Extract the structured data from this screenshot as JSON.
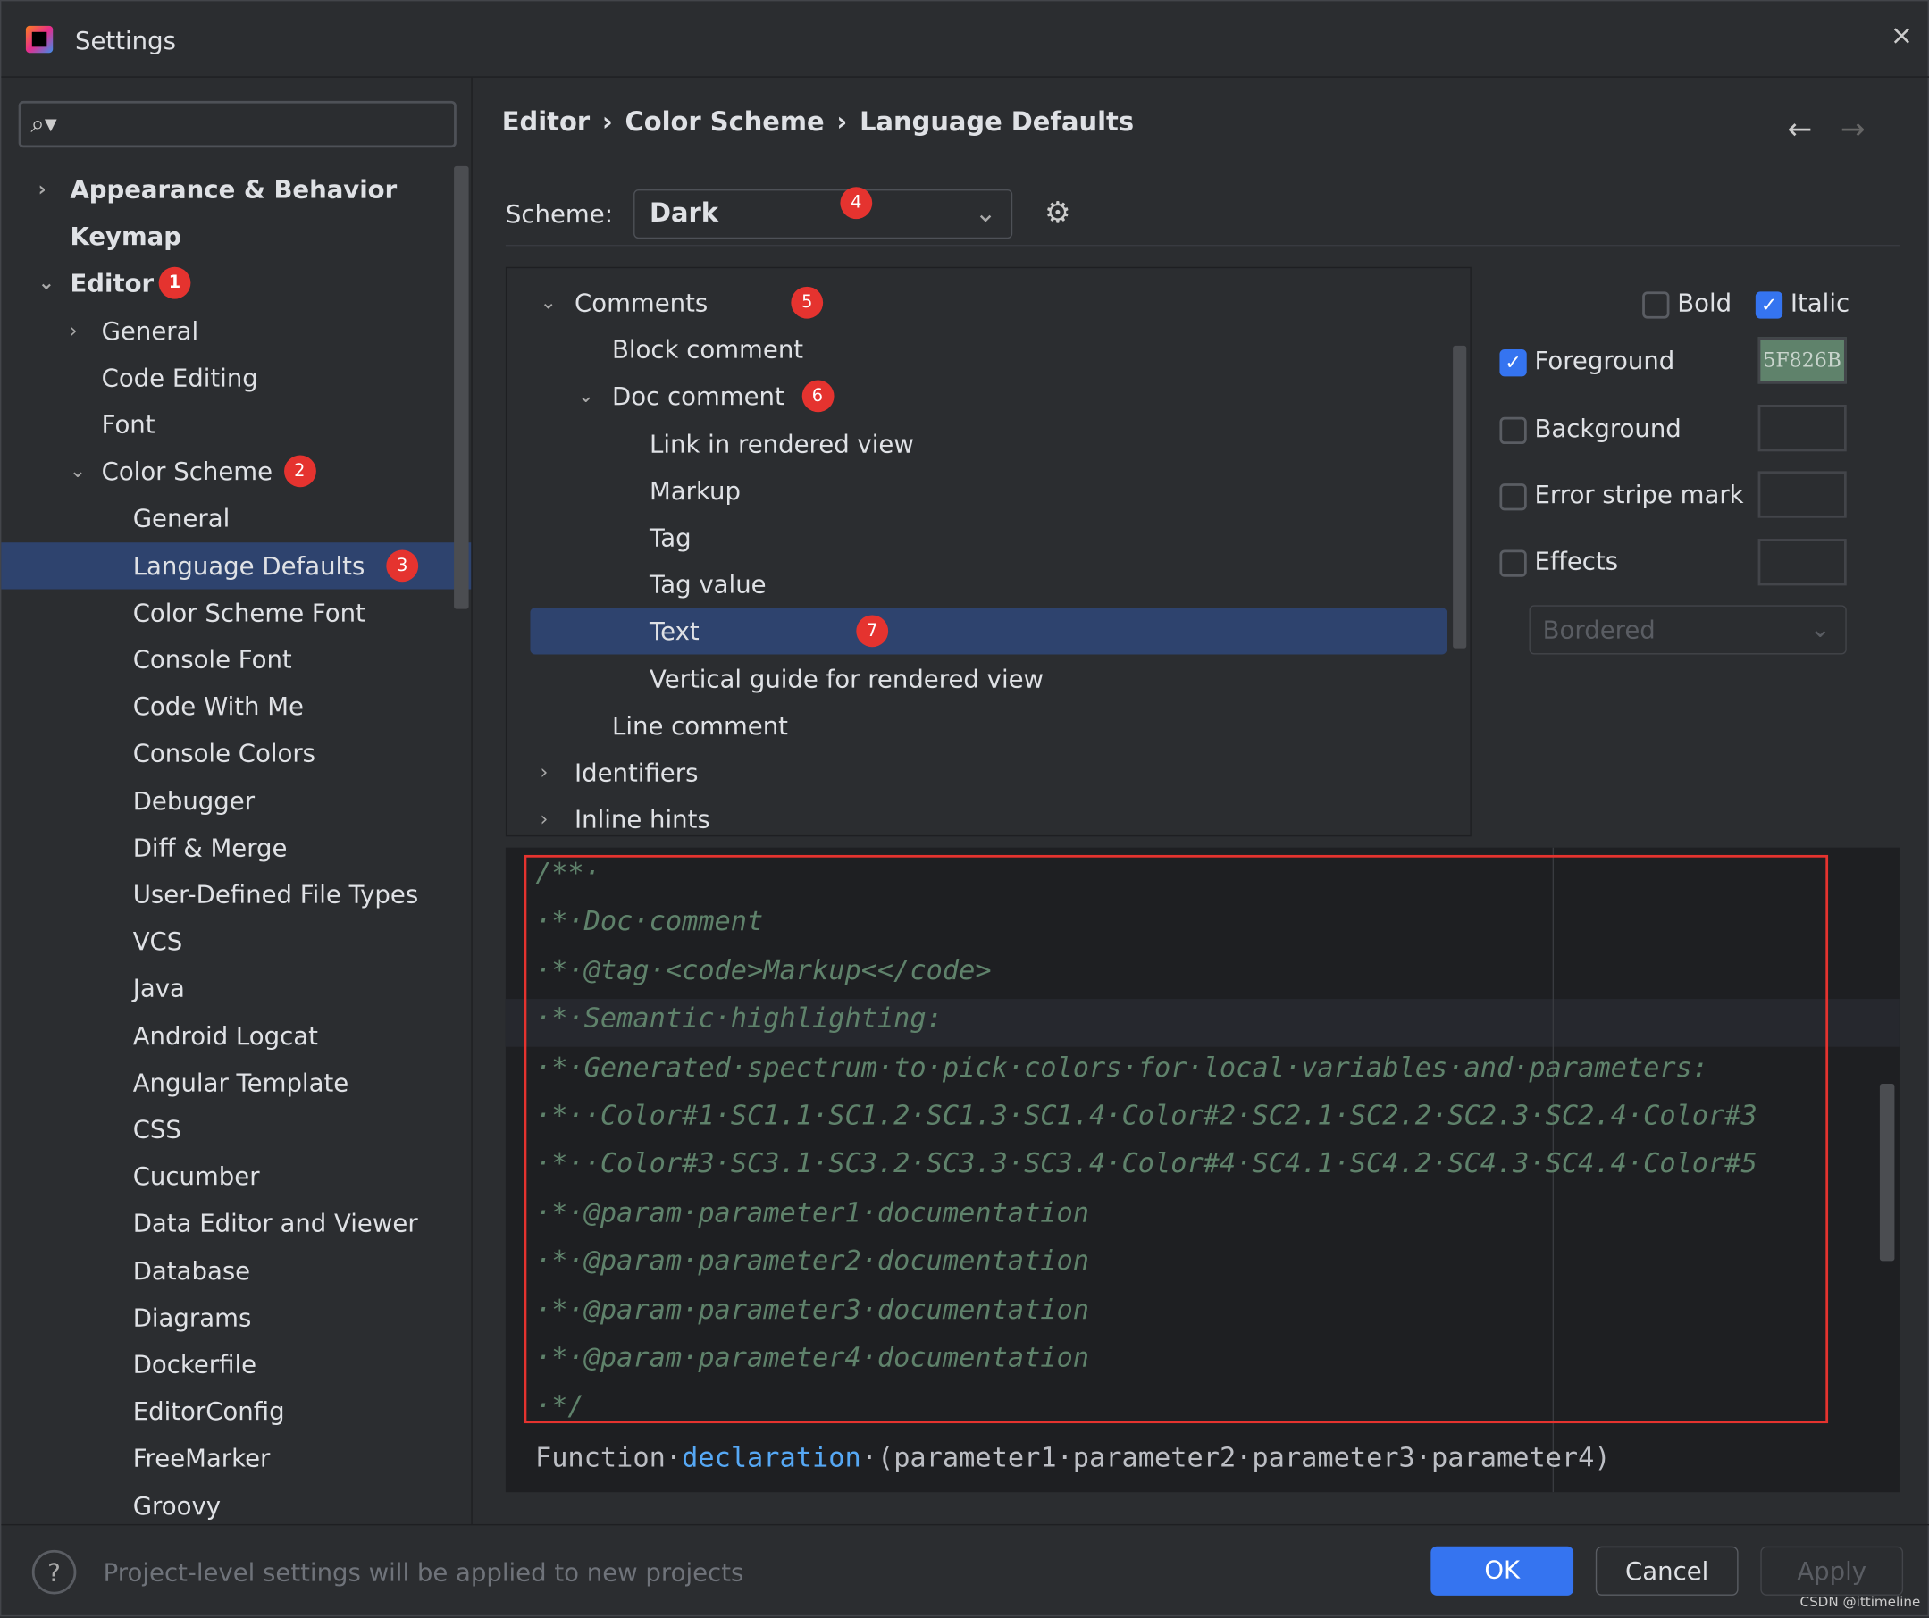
{
  "window": {
    "title": "Settings",
    "close": "×"
  },
  "search": {
    "icon": "⌕▾",
    "placeholder": ""
  },
  "sidebar": {
    "items": [
      {
        "label": "Appearance & Behavior",
        "level": 0,
        "bold": true,
        "chev": "›"
      },
      {
        "label": "Keymap",
        "level": 0,
        "bold": true,
        "chev": ""
      },
      {
        "label": "Editor",
        "level": 0,
        "bold": true,
        "chev": "⌄",
        "badge": "1"
      },
      {
        "label": "General",
        "level": 1,
        "chev": "›"
      },
      {
        "label": "Code Editing",
        "level": 1,
        "chev": ""
      },
      {
        "label": "Font",
        "level": 1,
        "chev": ""
      },
      {
        "label": "Color Scheme",
        "level": 1,
        "chev": "⌄",
        "badge": "2"
      },
      {
        "label": "General",
        "level": 2,
        "chev": ""
      },
      {
        "label": "Language Defaults",
        "level": 2,
        "chev": "",
        "badge": "3",
        "selected": true
      },
      {
        "label": "Color Scheme Font",
        "level": 2,
        "chev": ""
      },
      {
        "label": "Console Font",
        "level": 2,
        "chev": ""
      },
      {
        "label": "Code With Me",
        "level": 2,
        "chev": ""
      },
      {
        "label": "Console Colors",
        "level": 2,
        "chev": ""
      },
      {
        "label": "Debugger",
        "level": 2,
        "chev": ""
      },
      {
        "label": "Diff & Merge",
        "level": 2,
        "chev": ""
      },
      {
        "label": "User-Defined File Types",
        "level": 2,
        "chev": ""
      },
      {
        "label": "VCS",
        "level": 2,
        "chev": ""
      },
      {
        "label": "Java",
        "level": 2,
        "chev": ""
      },
      {
        "label": "Android Logcat",
        "level": 2,
        "chev": ""
      },
      {
        "label": "Angular Template",
        "level": 2,
        "chev": ""
      },
      {
        "label": "CSS",
        "level": 2,
        "chev": ""
      },
      {
        "label": "Cucumber",
        "level": 2,
        "chev": ""
      },
      {
        "label": "Data Editor and Viewer",
        "level": 2,
        "chev": ""
      },
      {
        "label": "Database",
        "level": 2,
        "chev": ""
      },
      {
        "label": "Diagrams",
        "level": 2,
        "chev": ""
      },
      {
        "label": "Dockerfile",
        "level": 2,
        "chev": ""
      },
      {
        "label": "EditorConfig",
        "level": 2,
        "chev": ""
      },
      {
        "label": "FreeMarker",
        "level": 2,
        "chev": ""
      },
      {
        "label": "Groovy",
        "level": 2,
        "chev": ""
      }
    ]
  },
  "breadcrumb": [
    "Editor",
    "›",
    "Color Scheme",
    "›",
    "Language Defaults"
  ],
  "nav": {
    "back": "←",
    "forward": "→"
  },
  "scheme": {
    "label": "Scheme:",
    "value": "Dark",
    "badge": "4",
    "gear": "⚙"
  },
  "attributes": [
    {
      "label": "Comments",
      "level": 0,
      "chev": "⌄",
      "badge": "5"
    },
    {
      "label": "Block comment",
      "level": 1,
      "chev": ""
    },
    {
      "label": "Doc comment",
      "level": 1,
      "chev": "⌄",
      "badge": "6"
    },
    {
      "label": "Link in rendered view",
      "level": 2,
      "chev": ""
    },
    {
      "label": "Markup",
      "level": 2,
      "chev": ""
    },
    {
      "label": "Tag",
      "level": 2,
      "chev": ""
    },
    {
      "label": "Tag value",
      "level": 2,
      "chev": ""
    },
    {
      "label": "Text",
      "level": 2,
      "chev": "",
      "badge": "7",
      "selected": true
    },
    {
      "label": "Vertical guide for rendered view",
      "level": 2,
      "chev": ""
    },
    {
      "label": "Line comment",
      "level": 1,
      "chev": ""
    },
    {
      "label": "Identifiers",
      "level": 0,
      "chev": "›"
    },
    {
      "label": "Inline hints",
      "level": 0,
      "chev": "›"
    }
  ],
  "props": {
    "bold": {
      "label": "Bold",
      "checked": false
    },
    "italic": {
      "label": "Italic",
      "checked": true
    },
    "foreground": {
      "label": "Foreground",
      "checked": true,
      "color": "#5F826B",
      "value": "5F826B"
    },
    "background": {
      "label": "Background",
      "checked": false
    },
    "error_stripe": {
      "label": "Error stripe mark",
      "checked": false
    },
    "effects": {
      "label": "Effects",
      "checked": false
    },
    "effect_type": "Bordered"
  },
  "preview": {
    "lines": [
      "/**·",
      "·*·Doc·comment",
      "·*·@tag·<code>Markup<</code>",
      "·*·Semantic·highlighting:",
      "·*·Generated·spectrum·to·pick·colors·for·local·variables·and·parameters:",
      "·*··Color#1·SC1.1·SC1.2·SC1.3·SC1.4·Color#2·SC2.1·SC2.2·SC2.3·SC2.4·Color#3",
      "·*··Color#3·SC3.1·SC3.2·SC3.3·SC3.4·Color#4·SC4.1·SC4.2·SC4.3·SC4.4·Color#5",
      "·*·@param·parameter1·documentation",
      "·*·@param·parameter2·documentation",
      "·*·@param·parameter3·documentation",
      "·*·@param·parameter4·documentation",
      "·*/"
    ],
    "func_kw": "Function·",
    "func_name": "declaration",
    "func_rest": "·(parameter1·parameter2·parameter3·parameter4)"
  },
  "footer": {
    "help": "?",
    "note": "Project-level settings will be applied to new projects",
    "ok": "OK",
    "cancel": "Cancel",
    "apply": "Apply"
  },
  "watermark": "CSDN @ittimeline"
}
